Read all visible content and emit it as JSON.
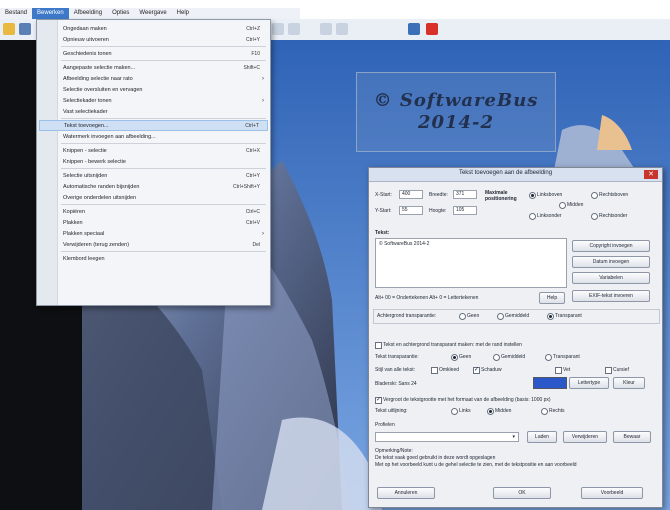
{
  "menubar": {
    "items": [
      "Bestand",
      "Bewerken",
      "Afbeelding",
      "Opties",
      "Weergave",
      "Help"
    ],
    "active": 1
  },
  "menu": {
    "items": [
      {
        "label": "Ongedaan maken",
        "shortcut": "Ctrl+Z",
        "arrow": false
      },
      {
        "label": "Opnieuw uitvoeren",
        "shortcut": "Ctrl+Y",
        "arrow": false
      },
      {
        "sep": true
      },
      {
        "label": "Geschiedenis tonen",
        "shortcut": "F10",
        "arrow": false
      },
      {
        "sep": true
      },
      {
        "label": "Aangepaste selectie maken...",
        "shortcut": "Shift+C",
        "arrow": false
      },
      {
        "label": "Afbeelding selectie naar rato",
        "shortcut": "",
        "arrow": true
      },
      {
        "label": "Selectie oversluiten en vervagen",
        "shortcut": "",
        "arrow": false
      },
      {
        "label": "Selectiekader tonen",
        "shortcut": "",
        "arrow": true
      },
      {
        "label": "Vast selectiekader",
        "shortcut": "",
        "arrow": false
      },
      {
        "sep": true
      },
      {
        "label": "Tekst toevoegen...",
        "shortcut": "Ctrl+T",
        "arrow": false,
        "highlight": true
      },
      {
        "label": "Watermerk invoegen aan afbeelding...",
        "shortcut": "",
        "arrow": false
      },
      {
        "sep": true
      },
      {
        "label": "Knippen - selectie",
        "shortcut": "Ctrl+X",
        "arrow": false
      },
      {
        "label": "Knippen - bewerk selectie",
        "shortcut": "",
        "arrow": false
      },
      {
        "sep": true
      },
      {
        "label": "Selectie uitsnijden",
        "shortcut": "Ctrl+Y",
        "arrow": false
      },
      {
        "label": "Automatische randen bijsnijden",
        "shortcut": "Ctrl+Shift+Y",
        "arrow": false
      },
      {
        "label": "Overige onderdelen uitsnijden",
        "shortcut": "",
        "arrow": false
      },
      {
        "sep": true
      },
      {
        "label": "Kopiëren",
        "shortcut": "Ctrl+C",
        "arrow": false
      },
      {
        "label": "Plakken",
        "shortcut": "Ctrl+V",
        "arrow": false
      },
      {
        "label": "Plakken speciaal",
        "shortcut": "",
        "arrow": true
      },
      {
        "label": "Verwijderen (terug zenden)",
        "shortcut": "Del",
        "arrow": false
      },
      {
        "sep": true
      },
      {
        "label": "Klembord leegen",
        "shortcut": "",
        "arrow": false
      }
    ]
  },
  "watermark": {
    "line1": "© SoftwareBus",
    "line2": "2014-2"
  },
  "dialog": {
    "title": "Tekst toevoegen aan de afbeelding",
    "close": "✕",
    "xstart_label": "X-Start:",
    "xstart_value": "400",
    "ystart_label": "Y-Start:",
    "ystart_value": "55",
    "breedte_label": "Breedte:",
    "breedte_value": "371",
    "hoogte_label": "Hoogte:",
    "hoogte_value": "105",
    "pos_label": "Maximale\npositionering",
    "pos_options": [
      "Linksboven",
      "Rechtsboven",
      "Midden",
      "Linksonder",
      "Rechtsonder"
    ],
    "tekst_label": "Tekst:",
    "tekst_value": "© SoftwareBus 2014-2",
    "btn_copyright": "Copyright invoegen",
    "btn_datum": "Datum invoegen",
    "btn_variabelen": "Variabelen",
    "btn_exif": "EXIF-tekst invoeren",
    "tabs_hint": "Alt+ 00 = Ondertekenen     Alt+ 0 = Lettertekenen",
    "btn_help": "Help",
    "achtergrond_label": "Achtergrond transparantie:",
    "ach_options": [
      "Geen",
      "Gemiddeld",
      "Transparant"
    ],
    "chk_tekst": "Tekst en achtergrond transparant maken: met de rand instellen",
    "tekst_transp_label": "Tekst transparantie:",
    "tt_options": [
      "Geen",
      "Gemiddeld",
      "Transparant"
    ],
    "stijl_label": "Stijl van alle tekst:",
    "stijl_options": [
      "Omkleed",
      "Schaduw",
      "Vet",
      "Cursief"
    ],
    "font_label": "Bladerski: Sans 24",
    "btn_lettertype": "Lettertype",
    "btn_kleur": "Kleur",
    "chk_vergroot": "Vergroot de tekstgrootte met het formaat van de afbeelding (basis: 1000 px)",
    "uitlijning_label": "Tekst uitlijning:",
    "uitlijning_options": [
      "Links",
      "Midden",
      "Rechts"
    ],
    "profielen_label": "Profielen",
    "btn_laden": "Laden",
    "btn_verwijderen": "Verwijderen",
    "btn_bewaar": "Bewaar",
    "opm_title": "Opmerking/Note:",
    "opm_line1": "De tekst vaak goed gebruikt in deze wordt opgeslagen",
    "opm_line2": "Met op het voorbeeld kunt u de gehel selectie te zien, met de tekstpositie en aan voorbeeld",
    "btn_annuleren": "Annuleren",
    "btn_ok": "OK",
    "btn_voorbeeld": "Voorbeeld"
  },
  "colors": {
    "accent": "#3d79c8",
    "swatch": "#2a58c8"
  }
}
